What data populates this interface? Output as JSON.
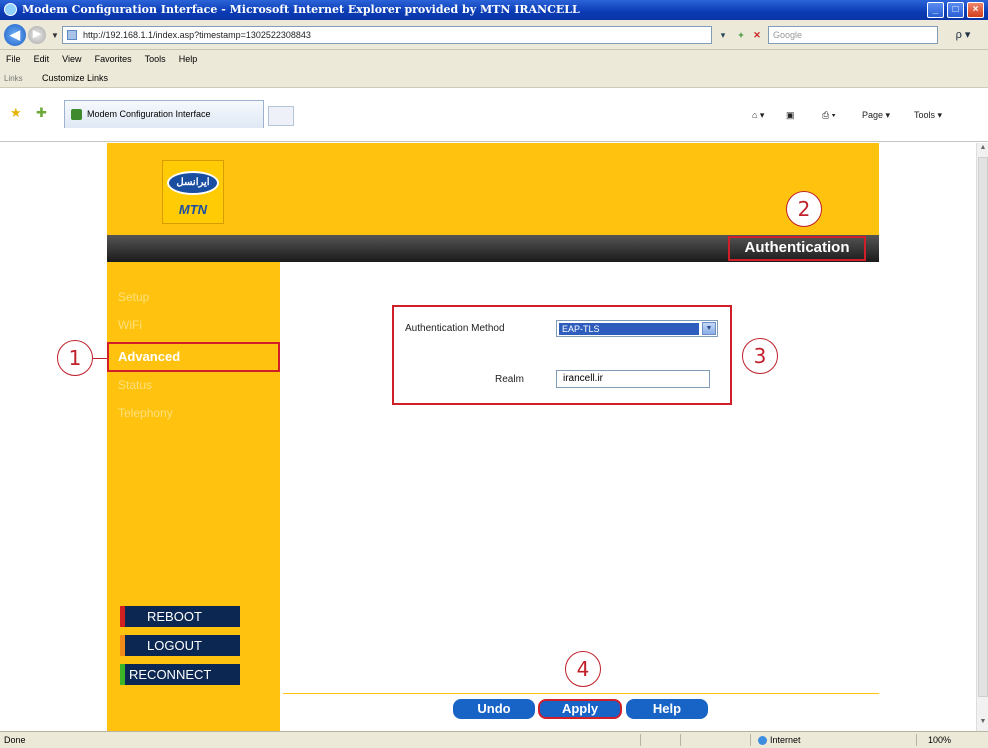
{
  "window": {
    "title": "Modem Configuration Interface - Microsoft Internet Explorer provided by MTN IRANCELL",
    "minimize": "_",
    "maximize": "□",
    "close": "×"
  },
  "addressbar": {
    "url": "http://192.168.1.1/index.asp?timestamp=1302522308843",
    "search_placeholder": "Google",
    "back": "◀",
    "forward": "▶",
    "go": "▾",
    "refresh": "+",
    "stop": "✕",
    "search_button": "ρ ▾"
  },
  "menu": [
    "File",
    "Edit",
    "View",
    "Favorites",
    "Tools",
    "Help"
  ],
  "links": {
    "label": "Links",
    "item": "Customize Links"
  },
  "tabbar": {
    "tab_label": "Modem Configuration Interface",
    "home": "⌂ ▾",
    "feeds": "▣",
    "print": "⎙ ▾",
    "page_menu": "Page ▾",
    "tools_menu": "Tools ▾"
  },
  "brand": {
    "logo_text": "ایرانسل",
    "logo_sub": "MTN"
  },
  "page": {
    "title": "Authentication"
  },
  "sidebar": {
    "items": [
      {
        "label": "Setup"
      },
      {
        "label": "WiFi"
      },
      {
        "label": "Advanced"
      },
      {
        "label": "Status"
      },
      {
        "label": "Telephony"
      }
    ],
    "buttons": {
      "reboot": "REBOOT",
      "logout": "LOGOUT",
      "reconnect": "RECONNECT"
    }
  },
  "form": {
    "auth_method_label": "Authentication Method",
    "auth_method_value": "EAP-TLS",
    "realm_label": "Realm",
    "realm_value": "irancell.ir"
  },
  "footer_buttons": {
    "undo": "Undo",
    "apply": "Apply",
    "help": "Help"
  },
  "callouts": [
    "1",
    "2",
    "3",
    "4"
  ],
  "statusbar": {
    "status": "Done",
    "zone": "Internet",
    "zoom": "100%"
  },
  "colors": {
    "brand_yellow": "#ffc20e",
    "highlight_red": "#d11f2a",
    "button_blue": "#1863c6",
    "title_blue": "#0a3bb4"
  }
}
